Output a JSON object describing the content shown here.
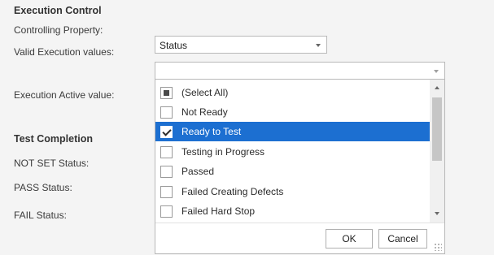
{
  "execution_control": {
    "heading": "Execution Control",
    "controlling_property_label": "Controlling Property:",
    "controlling_property_value": "Status",
    "valid_values_label": "Valid Execution values:",
    "valid_values_value": "",
    "active_value_label": "Execution Active value:"
  },
  "test_completion": {
    "heading": "Test Completion",
    "not_set_label": "NOT SET Status:",
    "pass_label": "PASS Status:",
    "fail_label": "FAIL Status:"
  },
  "dropdown": {
    "items": [
      {
        "label": "(Select All)",
        "state": "indeterminate",
        "selected": false
      },
      {
        "label": "Not Ready",
        "state": "unchecked",
        "selected": false
      },
      {
        "label": "Ready to Test",
        "state": "checked",
        "selected": true
      },
      {
        "label": "Testing in Progress",
        "state": "unchecked",
        "selected": false
      },
      {
        "label": "Passed",
        "state": "unchecked",
        "selected": false
      },
      {
        "label": "Failed Creating Defects",
        "state": "unchecked",
        "selected": false
      },
      {
        "label": "Failed Hard Stop",
        "state": "unchecked",
        "selected": false
      }
    ],
    "ok_label": "OK",
    "cancel_label": "Cancel"
  },
  "colors": {
    "selection": "#1c6fd1",
    "panel_background": "#f4f4f4"
  }
}
